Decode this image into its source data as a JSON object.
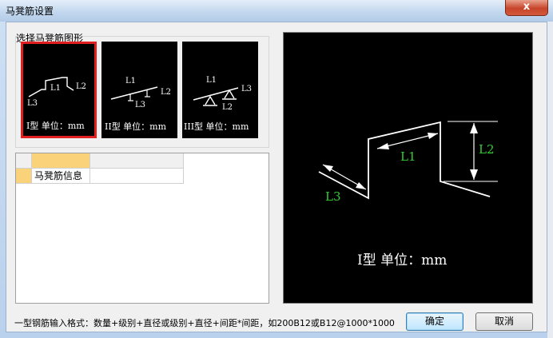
{
  "window": {
    "title": "马凳筋设置",
    "close_label": "x"
  },
  "shape_group": {
    "label": "选择马凳筋图形",
    "shapes": [
      {
        "caption": "I型 单位：mm",
        "l1": "L1",
        "l2": "L2",
        "l3": "L3",
        "selected": true
      },
      {
        "caption": "II型 单位：mm",
        "l1": "L1",
        "l2": "L2",
        "l3": "L3",
        "selected": false
      },
      {
        "caption": "III型 单位：mm",
        "l1": "L1",
        "l2": "L2",
        "l3": "L3",
        "selected": false
      }
    ]
  },
  "property_grid": {
    "rows": [
      {
        "name": "马凳筋信息",
        "value": ""
      }
    ]
  },
  "preview": {
    "caption": "I型 单位：mm",
    "l1": "L1",
    "l2": "L2",
    "l3": "L3",
    "dim_color": "#33cc33"
  },
  "hint": "一型钢筋输入格式：数量+级别+直径或级别+直径+间距*间距，如200B12或B12@1000*1000",
  "buttons": {
    "ok": "确定",
    "cancel": "取消"
  },
  "colors": {
    "selected_border": "#e02020",
    "grid_header": "#f9d27a"
  }
}
